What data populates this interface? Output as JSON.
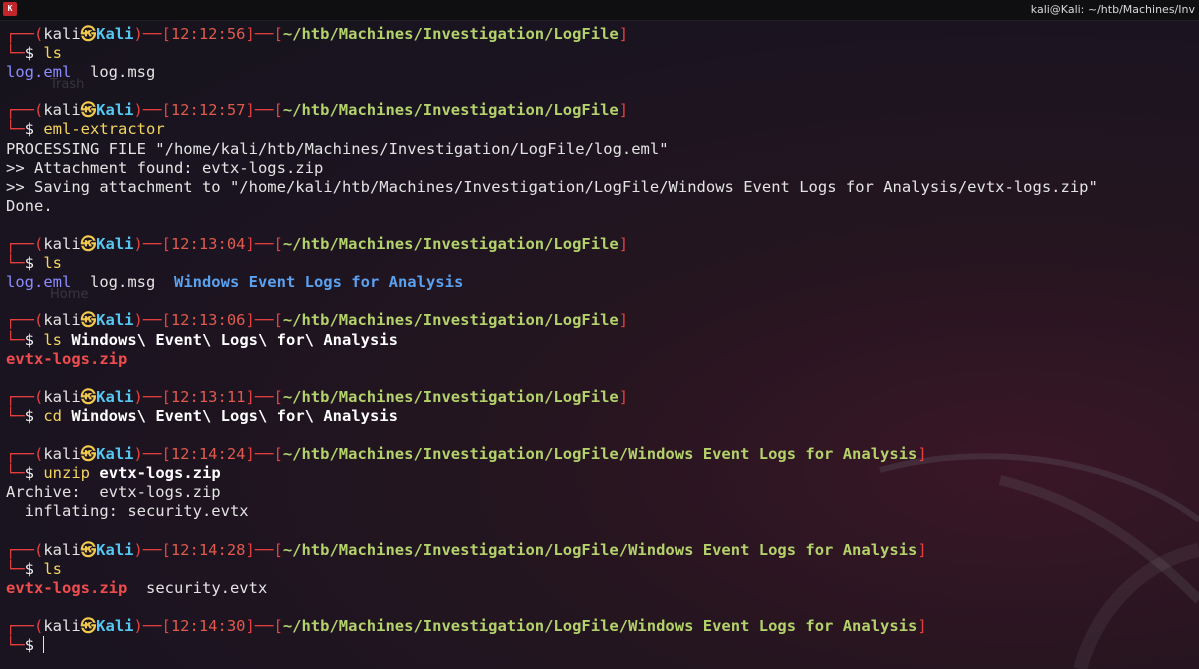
{
  "window": {
    "title": "kali@Kali: ~/htb/Machines/Inv",
    "app_icon_label": "K"
  },
  "desktop": {
    "trash_label": "Trash",
    "home_label": "Home"
  },
  "prompt": {
    "open": "┌──(",
    "user": "kali",
    "skull": "㉿",
    "host": "Kali",
    "mid": ")──[",
    "mid2": "]──[",
    "close": "]",
    "arrow": "└─",
    "dollar": "$ "
  },
  "paths": {
    "logfile": "~/htb/Machines/Investigation/LogFile",
    "analysis": "~/htb/Machines/Investigation/LogFile/Windows Event Logs for Analysis"
  },
  "blocks": [
    {
      "time": "12:12:56",
      "cmd": "ls",
      "args": "",
      "output": [
        [
          {
            "t": "log.eml",
            "c": "file-eml"
          },
          {
            "t": "  log.msg",
            "c": "plain"
          }
        ]
      ]
    },
    {
      "time": "12:12:57",
      "cmd": "eml-extractor",
      "args": "",
      "output": [
        [
          {
            "t": "PROCESSING FILE \"/home/kali/htb/Machines/Investigation/LogFile/log.eml\"",
            "c": "plain"
          }
        ],
        [
          {
            "t": ">> Attachment found: evtx-logs.zip",
            "c": "plain"
          }
        ],
        [
          {
            "t": ">> Saving attachment to \"/home/kali/htb/Machines/Investigation/LogFile/Windows Event Logs for Analysis/evtx-logs.zip\"",
            "c": "plain"
          }
        ],
        [
          {
            "t": "Done.",
            "c": "plain"
          }
        ]
      ]
    },
    {
      "time": "12:13:04",
      "cmd": "ls",
      "args": "",
      "output": [
        [
          {
            "t": "log.eml",
            "c": "file-eml"
          },
          {
            "t": "  log.msg  ",
            "c": "plain"
          },
          {
            "t": "Windows Event Logs for Analysis",
            "c": "dir"
          }
        ]
      ]
    },
    {
      "time": "12:13:06",
      "cmd": "ls",
      "args": "Windows\\ Event\\ Logs\\ for\\ Analysis",
      "output": [
        [
          {
            "t": "evtx-logs.zip",
            "c": "zip"
          }
        ]
      ]
    },
    {
      "time": "12:13:11",
      "cmd": "cd",
      "args": "Windows\\ Event\\ Logs\\ for\\ Analysis",
      "output": []
    },
    {
      "time": "12:14:24",
      "path": "analysis",
      "cmd": "unzip",
      "args": "evtx-logs.zip",
      "output": [
        [
          {
            "t": "Archive:  evtx-logs.zip",
            "c": "plain"
          }
        ],
        [
          {
            "t": "  inflating: security.evtx",
            "c": "plain"
          }
        ]
      ]
    },
    {
      "time": "12:14:28",
      "path": "analysis",
      "cmd": "ls",
      "args": "",
      "output": [
        [
          {
            "t": "evtx-logs.zip",
            "c": "zip"
          },
          {
            "t": "  security.evtx",
            "c": "plain"
          }
        ]
      ]
    },
    {
      "time": "12:14:30",
      "path": "analysis",
      "cmd": "",
      "args": "",
      "active": true,
      "output": []
    }
  ],
  "colors": {
    "prompt_frame": "#e4403f",
    "host": "#56c7f0",
    "path": "#b4d26b",
    "command": "#f4d55e",
    "directory": "#5aa1f0",
    "archive": "#ef4d4d"
  }
}
